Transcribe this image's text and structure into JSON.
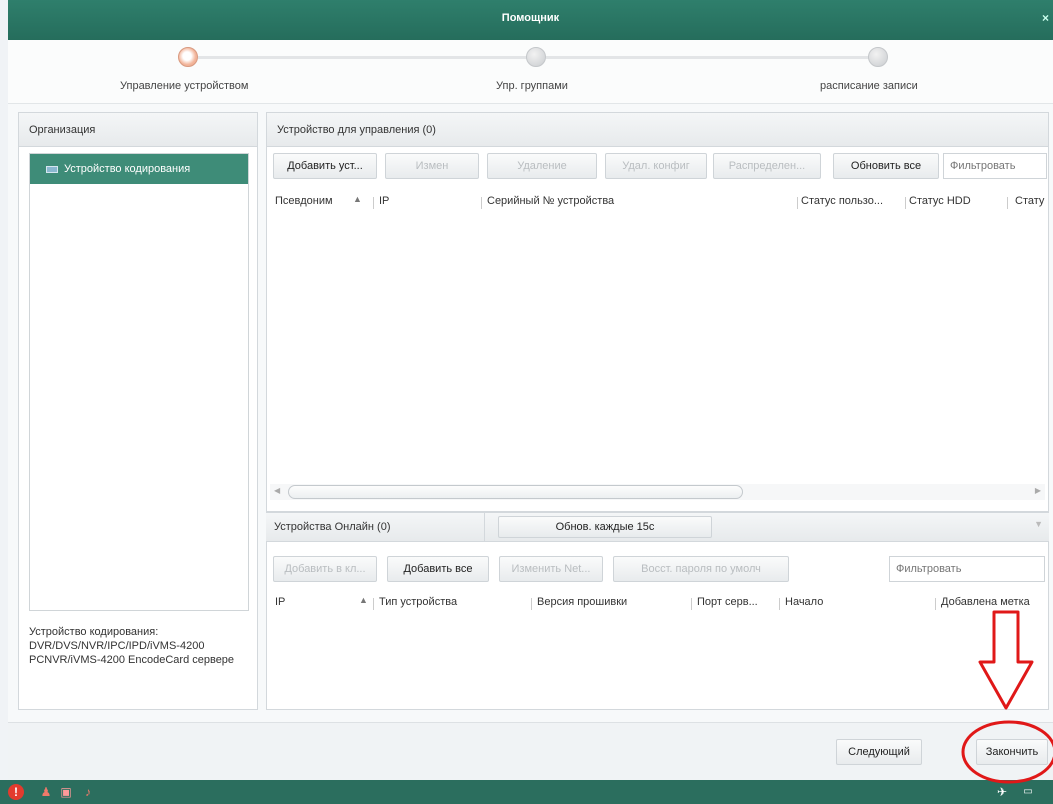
{
  "window": {
    "title": "Помощник",
    "close": "×"
  },
  "wizard": {
    "steps": [
      {
        "label": "Управление устройством",
        "active": true
      },
      {
        "label": "Упр. группами",
        "active": false
      },
      {
        "label": "расписание записи",
        "active": false
      }
    ]
  },
  "org_panel": {
    "title": "Организация",
    "items": [
      {
        "label": "Устройство кодирования",
        "icon": "device-icon"
      }
    ],
    "description": "Устройство кодирования: DVR/DVS/NVR/IPC/IPD/iVMS-4200 PCNVR/iVMS-4200 EncodeCard сервере"
  },
  "device_panel": {
    "title": "Устройство для управления (0)",
    "buttons": {
      "add": "Добавить уст...",
      "edit": "Измен",
      "delete": "Удаление",
      "remote_config": "Удал. конфиг",
      "distribute": "Распределен...",
      "refresh_all": "Обновить все"
    },
    "filter_placeholder": "Фильтровать",
    "columns": [
      "Псевдоним",
      "IP",
      "Серийный № устройства",
      "Статус пользо...",
      "Статус HDD",
      "Стату"
    ]
  },
  "online_panel": {
    "title": "Устройства Онлайн (0)",
    "refresh_button": "Обнов. каждые 15с",
    "buttons": {
      "add_to_client": "Добавить в кл...",
      "add_all": "Добавить все",
      "modify_net": "Изменить Net...",
      "restore_password": "Восст. пароля по умолч"
    },
    "filter_placeholder": "Фильтровать",
    "columns": [
      "IP",
      "Тип устройства",
      "Версия прошивки",
      "Порт серв...",
      "Начало",
      "Добавлена метка"
    ]
  },
  "footer": {
    "next": "Следующий",
    "finish": "Закончить"
  },
  "taskbar": {
    "icons": [
      "alarm-icon",
      "user-icon",
      "screen-icon",
      "speaker-icon",
      "pin-icon",
      "window-icon"
    ]
  },
  "colors": {
    "title_bar": "#2f7f6c",
    "selected_item": "#3e8c78",
    "annotation": "#e01818"
  }
}
